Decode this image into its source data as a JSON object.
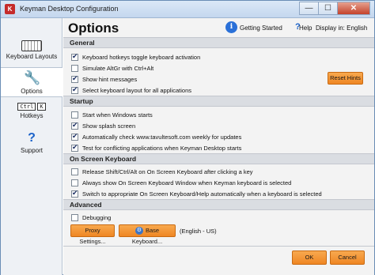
{
  "window": {
    "title": "Keyman Desktop Configuration",
    "minimize": "—",
    "maximize": "☐",
    "close": "✕"
  },
  "sidebar": {
    "items": [
      {
        "label": "Keyboard Layouts"
      },
      {
        "label": "Options"
      },
      {
        "label": "Hotkeys",
        "key1": "Ctrl",
        "key2": "K"
      },
      {
        "label": "Support"
      }
    ]
  },
  "header": {
    "title": "Options",
    "getting_started": "Getting Started",
    "help": "Help",
    "display_in": "Display in: English"
  },
  "sections": {
    "general": {
      "title": "General",
      "items": [
        {
          "label": "Keyboard hotkeys toggle keyboard activation",
          "checked": true
        },
        {
          "label": "Simulate AltGr with Ctrl+Alt",
          "checked": false
        },
        {
          "label": "Show hint messages",
          "checked": true
        },
        {
          "label": "Select keyboard layout for all applications",
          "checked": true
        }
      ],
      "reset_hints": "Reset Hints"
    },
    "startup": {
      "title": "Startup",
      "items": [
        {
          "label": "Start when Windows starts",
          "checked": false
        },
        {
          "label": "Show splash screen",
          "checked": true
        },
        {
          "label": "Automatically check www.tavultesoft.com weekly for updates",
          "checked": true
        },
        {
          "label": "Test for conflicting applications when Keyman Desktop starts",
          "checked": true
        }
      ]
    },
    "osk": {
      "title": "On Screen Keyboard",
      "items": [
        {
          "label": "Release Shift/Ctrl/Alt on On Screen Keyboard after clicking a key",
          "checked": false
        },
        {
          "label": "Always show On Screen Keyboard Window when Keyman keyboard is selected",
          "checked": false
        },
        {
          "label": "Switch to appropriate On Screen Keyboard/Help automatically when a keyboard is selected",
          "checked": true
        }
      ]
    },
    "advanced": {
      "title": "Advanced",
      "items": [
        {
          "label": "Debugging",
          "checked": false
        }
      ],
      "proxy_settings": "Proxy Settings...",
      "base_keyboard": "Base Keyboard...",
      "base_keyboard_value": "(English - US)"
    }
  },
  "footer": {
    "ok": "OK",
    "cancel": "Cancel"
  }
}
